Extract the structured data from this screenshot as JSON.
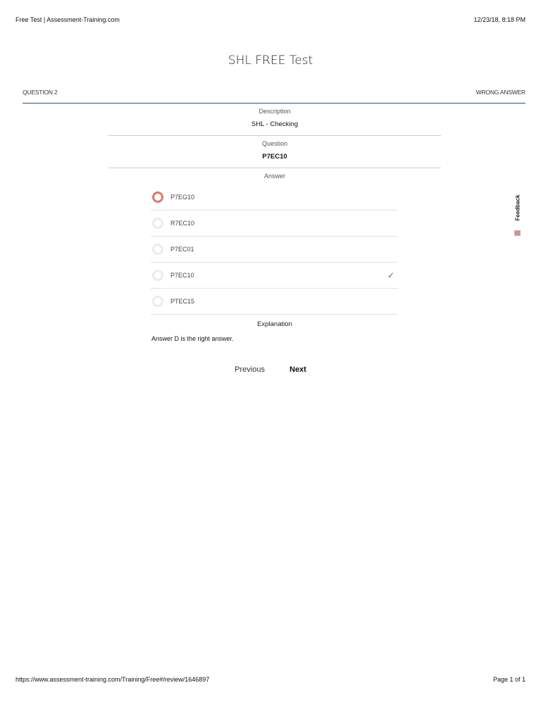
{
  "print_header": {
    "title": "Free Test | Assessment-Training.com",
    "datetime": "12/23/18, 8:18 PM"
  },
  "page": {
    "title": "SHL FREE Test"
  },
  "question_bar": {
    "question_number": "QUESTION 2",
    "result": "WRONG ANSWER"
  },
  "description": {
    "label": "Description",
    "value": "SHL - Checking"
  },
  "question": {
    "label": "Question",
    "value": "P7EC10"
  },
  "answer": {
    "label": "Answer",
    "options": [
      {
        "label": "P7EG10",
        "selected": true,
        "correct": false
      },
      {
        "label": "R7EC10",
        "selected": false,
        "correct": false
      },
      {
        "label": "P7EC01",
        "selected": false,
        "correct": false
      },
      {
        "label": "P7EC10",
        "selected": false,
        "correct": true
      },
      {
        "label": "PTEC15",
        "selected": false,
        "correct": false
      }
    ],
    "check_icon": "checkmark-icon"
  },
  "explanation": {
    "label": "Explanation",
    "text": "Answer D is the right answer."
  },
  "navigation": {
    "previous_label": "Previous",
    "next_label": "Next"
  },
  "feedback": {
    "label": "Feedback",
    "icon": "feedback-icon"
  },
  "print_footer": {
    "url": "https://www.assessment-training.com/Training/Free#/review/1646897",
    "page": "Page 1 of 1"
  },
  "colors": {
    "selected_radio": "#e07a6a",
    "bar_line": "#2d4f73"
  }
}
